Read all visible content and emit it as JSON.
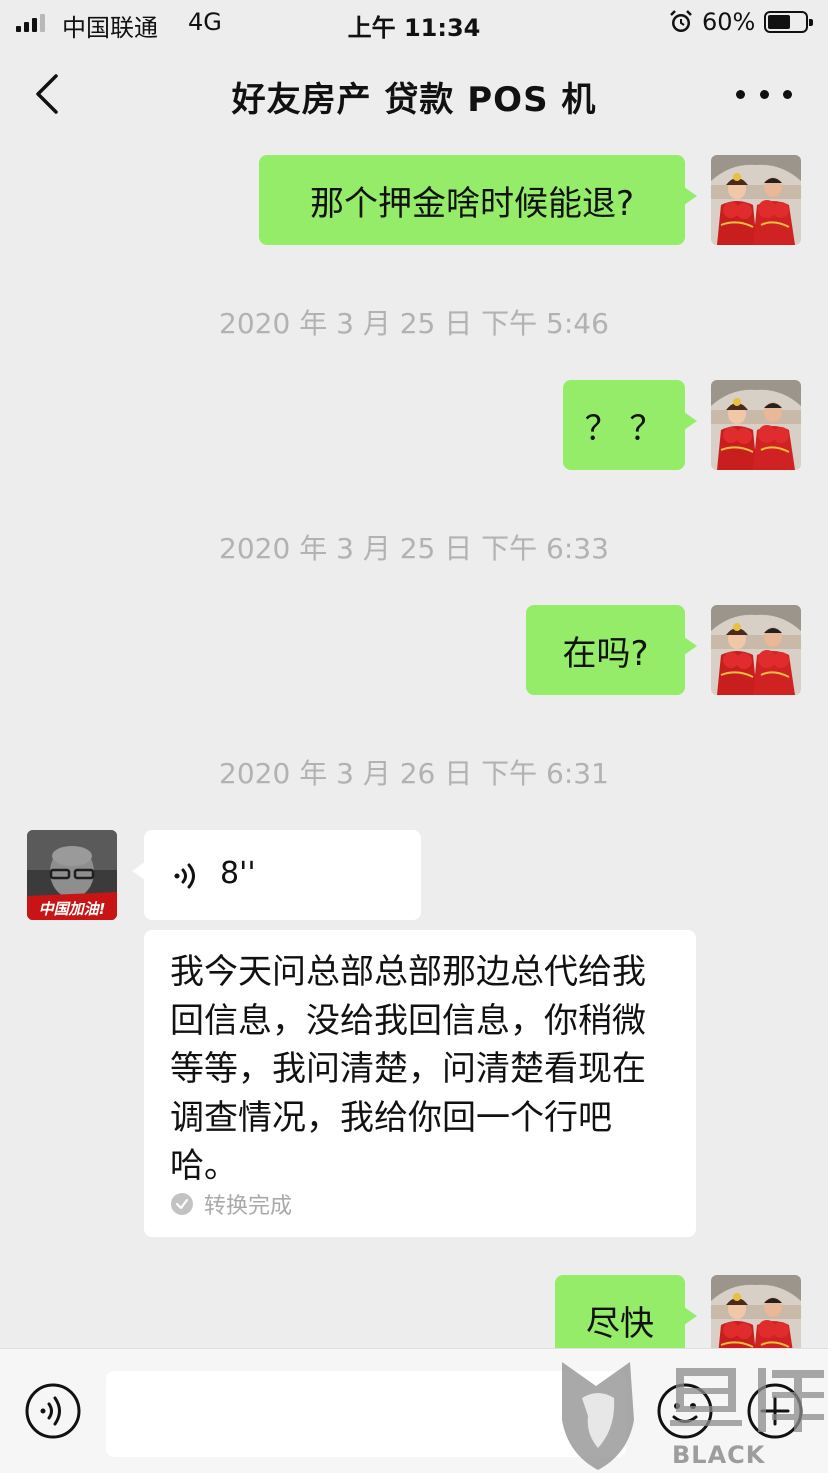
{
  "status_bar": {
    "carrier": "中国联通",
    "network": "4G",
    "time": "上午 11:34",
    "battery_percent": "60%",
    "battery_level": 0.6,
    "icons": [
      "signal-icon",
      "alarm-icon",
      "battery-icon"
    ]
  },
  "nav": {
    "title": "好友房产  贷款  POS 机",
    "icons": [
      "back-icon",
      "more-icon"
    ]
  },
  "messages": [
    {
      "from": "me",
      "type": "text",
      "text": "那个押金啥时候能退?"
    },
    {
      "type": "timestamp",
      "text": "2020 年 3 月 25 日  下午 5:46"
    },
    {
      "from": "me",
      "type": "text",
      "text": "？ ？"
    },
    {
      "type": "timestamp",
      "text": "2020 年 3 月 25 日  下午 6:33"
    },
    {
      "from": "me",
      "type": "text",
      "text": "在吗?"
    },
    {
      "type": "timestamp",
      "text": "2020 年 3 月 26 日  下午 6:31"
    },
    {
      "from": "them",
      "type": "voice",
      "duration": "8''",
      "avatar_badge": "中国加油!"
    },
    {
      "from": "them",
      "type": "transcript",
      "text": "我今天问总部总部那边总代给我回信息，没给我回信息，你稍微等等，我问清楚，问清楚看现在调查情况，我给你回一个行吧哈。",
      "status": "转换完成"
    },
    {
      "from": "me",
      "type": "text",
      "text": "尽快"
    }
  ],
  "input_bar": {
    "placeholder": "",
    "icons": [
      "voice-input-icon",
      "emoji-icon",
      "plus-icon"
    ]
  },
  "watermark": {
    "text": "BLACK CAT",
    "logo_text": "黑猫"
  },
  "colors": {
    "background": "#ededed",
    "my_bubble": "#95ec69",
    "their_bubble": "#ffffff",
    "timestamp": "#b2b2b2"
  }
}
